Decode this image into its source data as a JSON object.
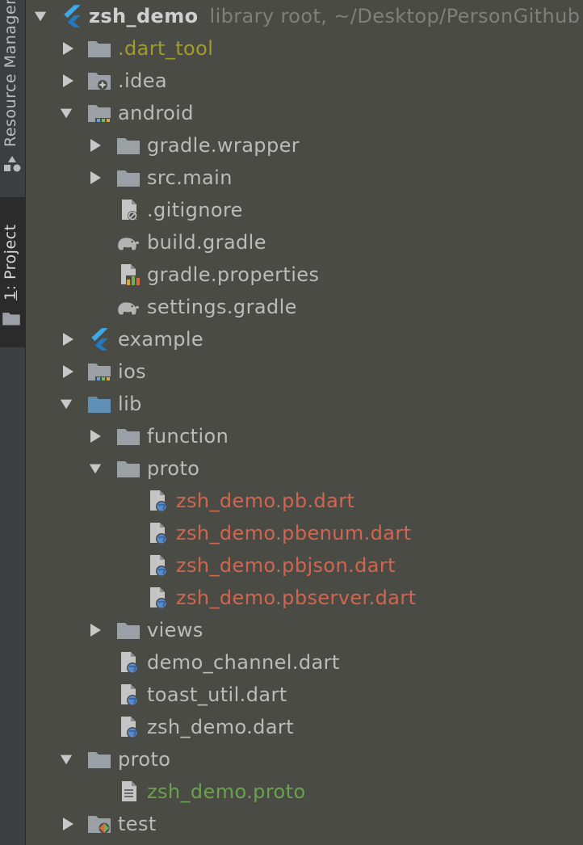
{
  "sidebar": {
    "resource_tab_label": "Resource Manager",
    "project_tab_number": "1",
    "project_tab_label": ": Project"
  },
  "tree": {
    "root": {
      "name": "zsh_demo",
      "hint": "library root,  ~/Desktop/PersonGithub"
    },
    "dart_tool": ".dart_tool",
    "idea": ".idea",
    "android": "android",
    "gradle_wrapper": "gradle.wrapper",
    "src_main": "src.main",
    "gitignore": ".gitignore",
    "build_gradle": "build.gradle",
    "gradle_properties": "gradle.properties",
    "settings_gradle": "settings.gradle",
    "example": "example",
    "ios": "ios",
    "lib": "lib",
    "function": "function",
    "proto_dir": "proto",
    "pb_dart": "zsh_demo.pb.dart",
    "pbenum_dart": "zsh_demo.pbenum.dart",
    "pbjson_dart": "zsh_demo.pbjson.dart",
    "pbserver_dart": "zsh_demo.pbserver.dart",
    "views": "views",
    "demo_channel": "demo_channel.dart",
    "toast_util": "toast_util.dart",
    "zsh_demo_dart": "zsh_demo.dart",
    "proto_root": "proto",
    "zsh_demo_proto": "zsh_demo.proto",
    "test": "test"
  },
  "colors": {
    "background": "#4b4b46",
    "text": "#bbbbbb",
    "ignored": "#a09c2c",
    "modified": "#d0664f",
    "added": "#69a24d",
    "flutter_blue": "#3fa9e8"
  }
}
